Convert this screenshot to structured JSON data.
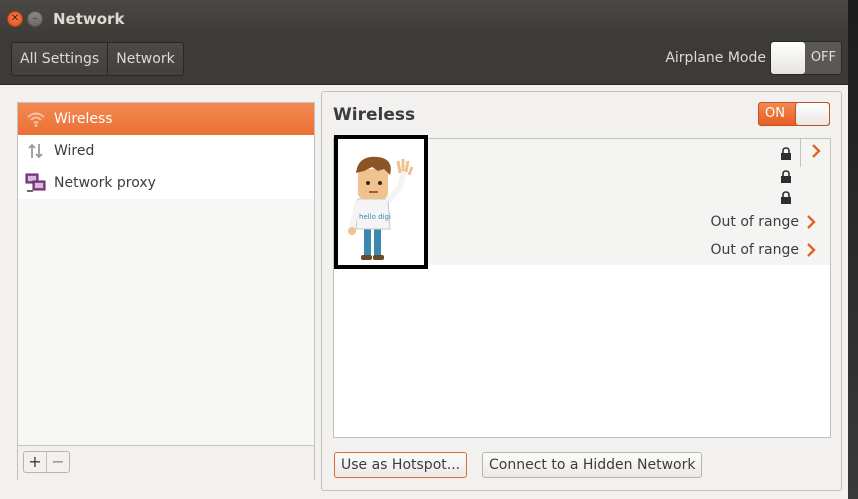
{
  "window": {
    "title": "Network"
  },
  "breadcrumbs": [
    "All Settings",
    "Network"
  ],
  "airplane": {
    "label": "Airplane Mode",
    "state": "OFF"
  },
  "sidebar": {
    "items": [
      {
        "label": "Wireless",
        "icon": "wifi-icon",
        "selected": true
      },
      {
        "label": "Wired",
        "icon": "wired-icon",
        "selected": false
      },
      {
        "label": "Network proxy",
        "icon": "network-proxy-icon",
        "selected": false
      }
    ],
    "add": "+",
    "remove": "−"
  },
  "wireless": {
    "title": "Wireless",
    "state": "ON",
    "networks": [
      {
        "status": "",
        "locked": true
      },
      {
        "status": "",
        "locked": true
      },
      {
        "status": "",
        "locked": true
      },
      {
        "status": "Out of range",
        "locked": false
      },
      {
        "status": "Out of range",
        "locked": false
      }
    ],
    "avatar_shirt_text": "hello digi"
  },
  "buttons": {
    "hotspot": "Use as Hotspot...",
    "hidden": "Connect to a Hidden Network"
  },
  "colors": {
    "accent": "#ef7238",
    "titlebar": "#3d3b37"
  }
}
